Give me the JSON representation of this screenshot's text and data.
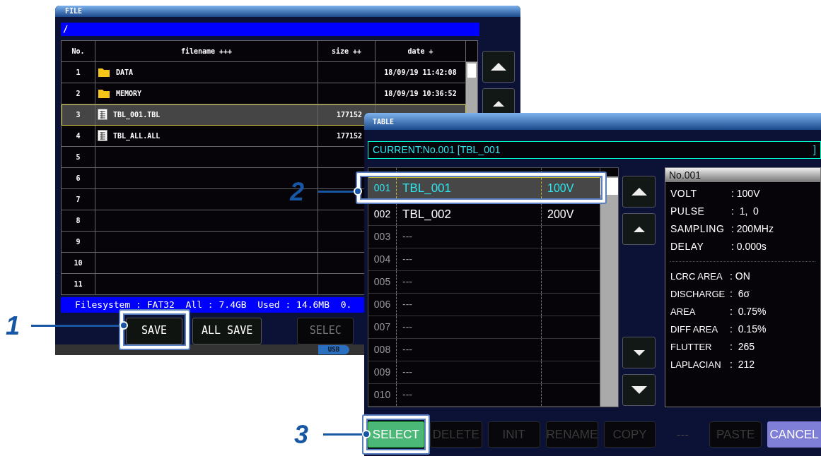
{
  "file_window": {
    "title": "FILE",
    "path": "/",
    "columns": [
      "No.",
      "filename +++",
      "size ++",
      "date +"
    ],
    "rows": [
      {
        "no": "1",
        "kind": "folder",
        "name": "DATA",
        "date": "18/09/19 11:42:08",
        "selected": false
      },
      {
        "no": "2",
        "kind": "folder",
        "name": "MEMORY",
        "date": "18/09/19 10:36:52",
        "selected": false
      },
      {
        "no": "3",
        "kind": "table",
        "name": "TBL_001.TBL",
        "size": "177152",
        "selected": true
      },
      {
        "no": "4",
        "kind": "table",
        "name": "TBL_ALL.ALL",
        "size": "177152",
        "selected": false
      },
      {
        "no": "5",
        "kind": "empty",
        "selected": false
      },
      {
        "no": "6",
        "kind": "empty",
        "selected": false
      },
      {
        "no": "7",
        "kind": "empty",
        "selected": false
      },
      {
        "no": "8",
        "kind": "empty",
        "selected": false
      },
      {
        "no": "9",
        "kind": "empty",
        "selected": false
      },
      {
        "no": "10",
        "kind": "empty",
        "selected": false
      },
      {
        "no": "11",
        "kind": "empty",
        "selected": false
      }
    ],
    "status": "Filesystem : FAT32  All : 7.4GB  Used : 14.6MB  0.",
    "buttons": [
      {
        "label": "SAVE",
        "disabled": false
      },
      {
        "label": "ALL SAVE",
        "disabled": false
      },
      {
        "label": "SELEC",
        "disabled": true
      }
    ],
    "usb": "USB"
  },
  "table_window": {
    "title": "TABLE",
    "current": "CURRENT:No.001 [TBL_001",
    "current_end": "]",
    "rows": [
      {
        "no": "001",
        "kind": "entry",
        "name": "TBL_001",
        "volt": "100V",
        "selected": true
      },
      {
        "no": "002",
        "kind": "entry",
        "name": "TBL_002",
        "volt": "200V",
        "selected": false
      },
      {
        "no": "003",
        "kind": "empty",
        "name": "---",
        "selected": false
      },
      {
        "no": "004",
        "kind": "empty",
        "name": "---",
        "selected": false
      },
      {
        "no": "005",
        "kind": "empty",
        "name": "---",
        "selected": false
      },
      {
        "no": "006",
        "kind": "empty",
        "name": "---",
        "selected": false
      },
      {
        "no": "007",
        "kind": "empty",
        "name": "---",
        "selected": false
      },
      {
        "no": "008",
        "kind": "empty",
        "name": "---",
        "selected": false
      },
      {
        "no": "009",
        "kind": "empty",
        "name": "---",
        "selected": false
      },
      {
        "no": "010",
        "kind": "empty",
        "name": "---",
        "selected": false
      }
    ],
    "detail": {
      "title": "No.001",
      "settings": [
        {
          "label": "VOLT",
          "value": ": 100V"
        },
        {
          "label": "PULSE",
          "value": ":  1,  0"
        },
        {
          "label": "SAMPLING",
          "value": ": 200MHz"
        },
        {
          "label": "DELAY",
          "value": ": 0.000s"
        }
      ],
      "judgement": [
        {
          "label": "LCRC AREA",
          "value": ": ON"
        },
        {
          "label": "DISCHARGE",
          "value": ":  6σ"
        },
        {
          "label": "AREA",
          "value": ":  0.75%"
        },
        {
          "label": "DIFF AREA",
          "value": ":  0.15%"
        },
        {
          "label": "FLUTTER",
          "value": ":  265"
        },
        {
          "label": "LAPLACIAN",
          "value": ":  212"
        }
      ]
    },
    "buttons": [
      {
        "kind": "select",
        "label": "SELECT"
      },
      {
        "kind": "disabled",
        "label": "DELETE"
      },
      {
        "kind": "disabled",
        "label": "INIT"
      },
      {
        "kind": "disabled",
        "label": "RENAME"
      },
      {
        "kind": "disabled",
        "label": "COPY"
      },
      {
        "kind": "text",
        "label": "---"
      },
      {
        "kind": "disabled",
        "label": "PASTE"
      },
      {
        "kind": "cancel",
        "label": "CANCEL"
      }
    ]
  },
  "callouts": [
    {
      "number": "1"
    },
    {
      "number": "2"
    },
    {
      "number": "3"
    }
  ]
}
